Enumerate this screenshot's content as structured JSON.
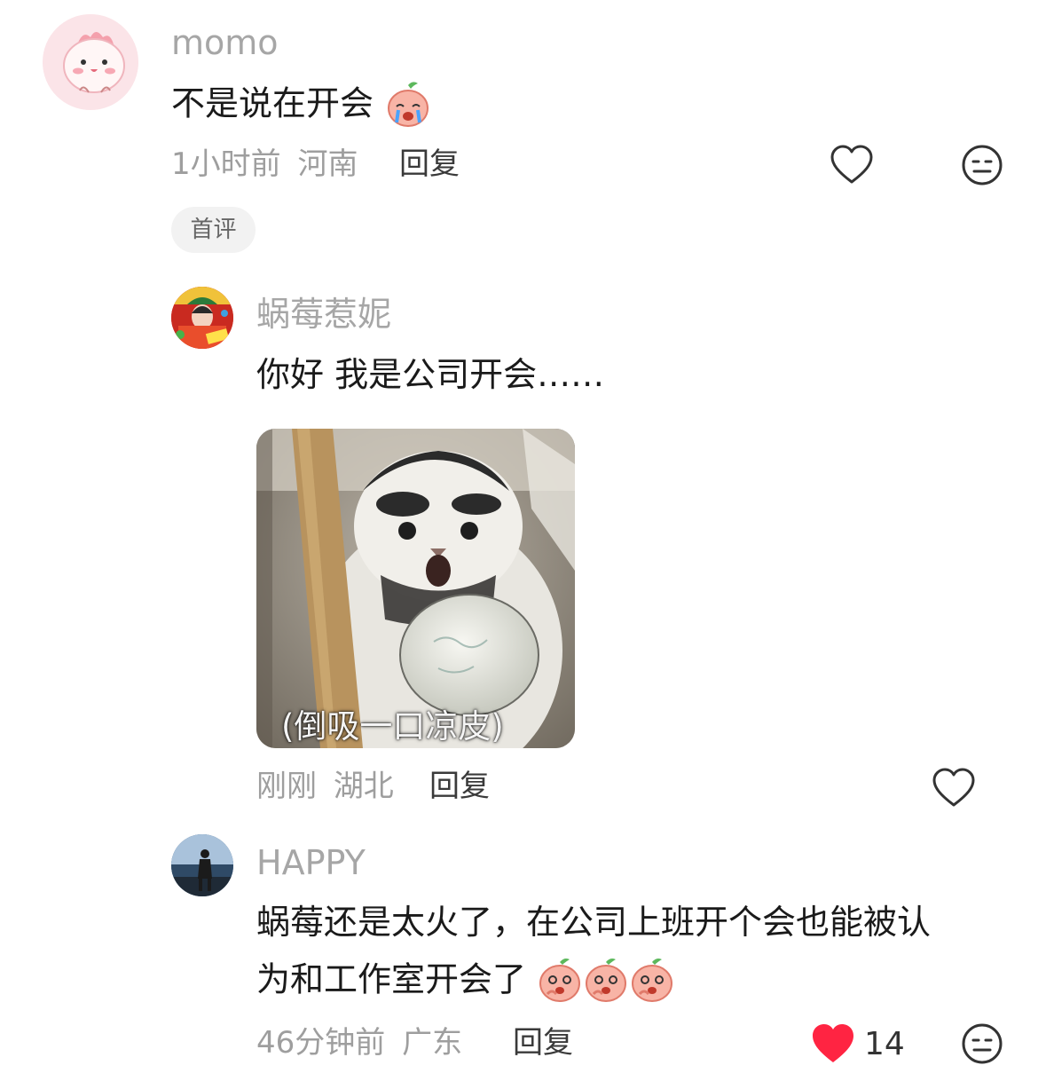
{
  "comments": [
    {
      "username": "momo",
      "text": "不是说在开会",
      "time": "1小时前",
      "location": "河南",
      "reply_label": "回复",
      "badge": "首评"
    },
    {
      "username": "蜗莓惹妮",
      "text": "你好 我是公司开会……",
      "image_caption": "(倒吸一口凉皮)",
      "time": "刚刚",
      "location": "湖北",
      "reply_label": "回复"
    },
    {
      "username": "HAPPY",
      "text_line1": "蜗莓还是太火了，在公司上班开个会也能被认",
      "text_line2": "为和工作室开会了",
      "time": "46分钟前",
      "location": "广东",
      "reply_label": "回复",
      "like_count": "14",
      "liked": true
    }
  ],
  "colors": {
    "like_active": "#ff2442",
    "meta_text": "#9e9e9e",
    "username": "#a6a6a6"
  },
  "icons": [
    "heart-outline-icon",
    "heart-filled-icon",
    "neutral-face-icon",
    "peach-emoji"
  ]
}
